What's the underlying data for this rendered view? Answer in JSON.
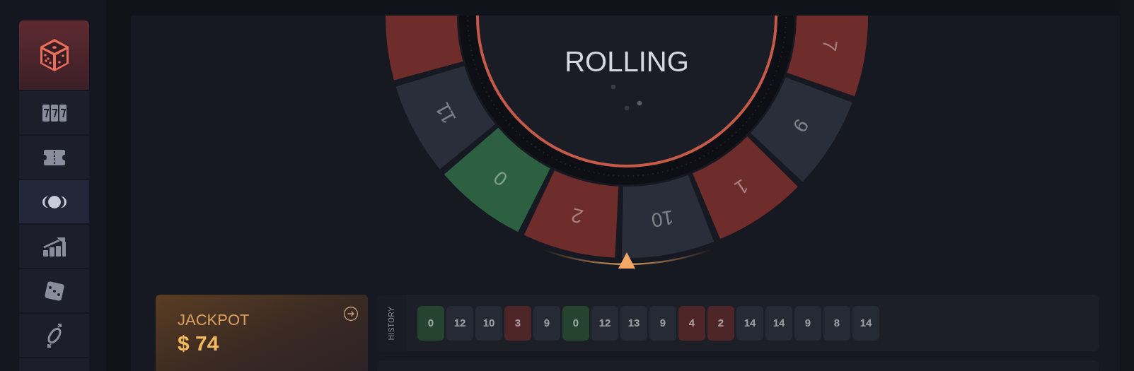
{
  "sidebar": {
    "items": [
      {
        "selected": true,
        "highlighted": false
      },
      {
        "selected": false,
        "highlighted": false
      },
      {
        "selected": false,
        "highlighted": false
      },
      {
        "selected": false,
        "highlighted": true
      },
      {
        "selected": false,
        "highlighted": false
      },
      {
        "selected": false,
        "highlighted": false
      },
      {
        "selected": false,
        "highlighted": false
      },
      {
        "selected": false,
        "highlighted": false
      }
    ]
  },
  "wheel": {
    "status": "ROLLING",
    "segments": [
      {
        "label": "7",
        "color": "#6e2c2a"
      },
      {
        "label": "9",
        "color": "#2a2e3a"
      },
      {
        "label": "1",
        "color": "#6e2c2a"
      },
      {
        "label": "10",
        "color": "#2a2e3a"
      },
      {
        "label": "2",
        "color": "#6e2c2a"
      },
      {
        "label": "0",
        "color": "#2d6040"
      },
      {
        "label": "11",
        "color": "#2a2e3a"
      },
      {
        "color": "#6e2c2a"
      }
    ]
  },
  "jackpot": {
    "title": "JACKPOT",
    "amount": "$ 74"
  },
  "history": {
    "label": "HISTORY",
    "results": [
      {
        "value": "0",
        "color": "#26432f"
      },
      {
        "value": "12",
        "color": "#262a35"
      },
      {
        "value": "10",
        "color": "#262a35"
      },
      {
        "value": "3",
        "color": "#4e2628"
      },
      {
        "value": "9",
        "color": "#262a35"
      },
      {
        "value": "0",
        "color": "#26432f"
      },
      {
        "value": "12",
        "color": "#262a35"
      },
      {
        "value": "13",
        "color": "#262a35"
      },
      {
        "value": "9",
        "color": "#262a35"
      },
      {
        "value": "4",
        "color": "#4e2628"
      },
      {
        "value": "2",
        "color": "#4e2628"
      },
      {
        "value": "14",
        "color": "#262a35"
      },
      {
        "value": "14",
        "color": "#262a35"
      },
      {
        "value": "9",
        "color": "#262a35"
      },
      {
        "value": "8",
        "color": "#262a35"
      },
      {
        "value": "14",
        "color": "#262a35"
      }
    ]
  }
}
